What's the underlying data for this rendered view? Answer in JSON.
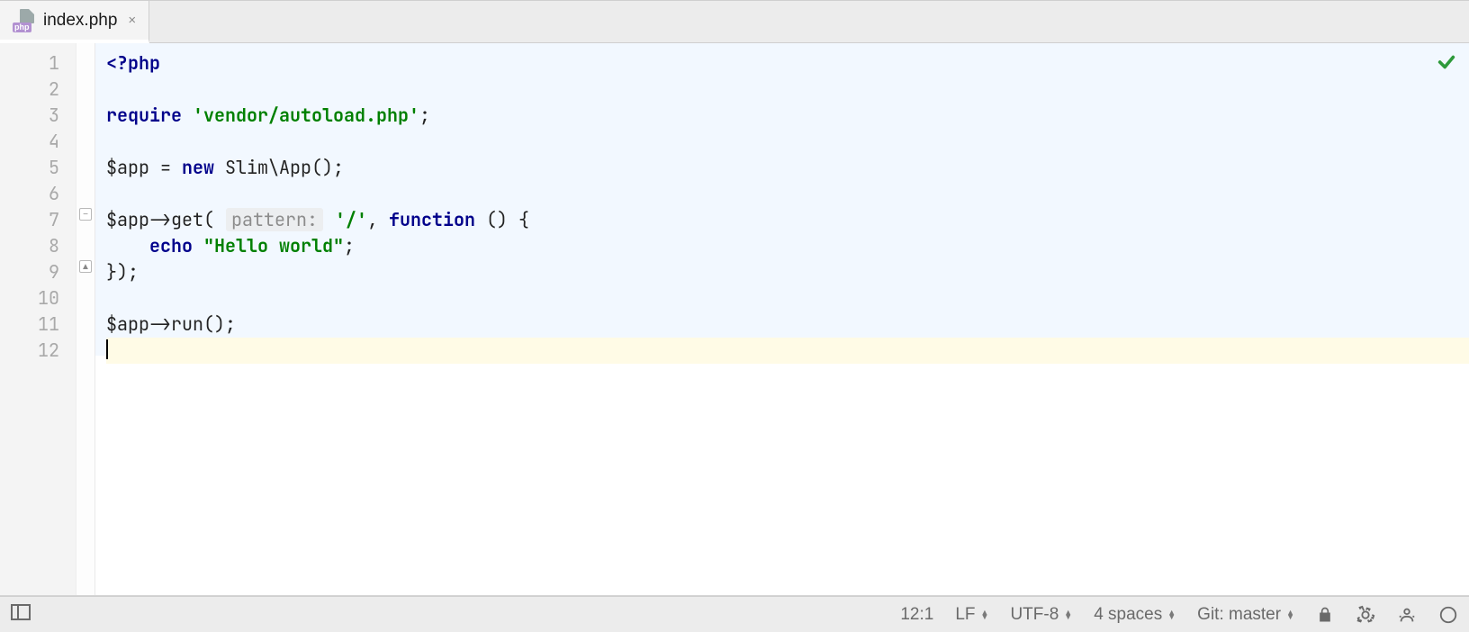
{
  "tab": {
    "filename": "index.php",
    "filetype_badge": "php"
  },
  "gutter": {
    "lines": [
      "1",
      "2",
      "3",
      "4",
      "5",
      "6",
      "7",
      "8",
      "9",
      "10",
      "11",
      "12"
    ]
  },
  "code": {
    "l1_open": "<?php",
    "l3_require": "require",
    "l3_str": "'vendor/autoload.php'",
    "l3_semi": ";",
    "l5_var": "$app",
    "l5_eq": " = ",
    "l5_new": "new",
    "l5_class": " Slim\\App()",
    "l5_semi": ";",
    "l7_var": "$app",
    "l7_arrow": "->get( ",
    "l7_hint": "pattern:",
    "l7_str": " '/'",
    "l7_comma": ", ",
    "l7_func": "function",
    "l7_rest": " () {",
    "l8_echo": "echo",
    "l8_str": " \"Hello world\"",
    "l8_semi": ";",
    "l9": "});",
    "l11_var": "$app",
    "l11_rest": "->run();"
  },
  "status": {
    "caret": "12:1",
    "eol": "LF",
    "encoding": "UTF-8",
    "indent": "4 spaces",
    "git": "Git: master"
  }
}
